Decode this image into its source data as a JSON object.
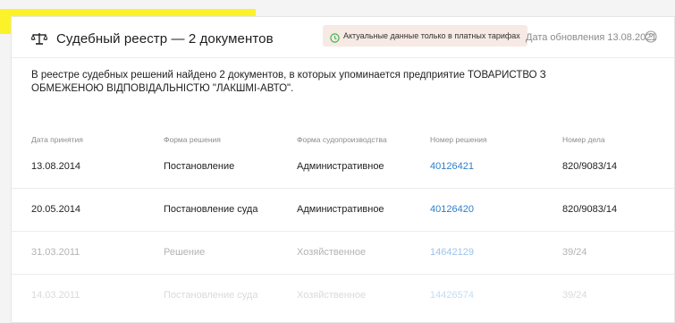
{
  "header": {
    "title": "Судебный реестр — 2 документов",
    "badge_text": "Актуальные данные только в платных тарифах",
    "updated": "Дата обновления 13.08.2021",
    "highlight_color": "#fbf22a",
    "icons": [
      "scales-icon",
      "clock-icon",
      "help-icon"
    ]
  },
  "description": "В реестре судебных решений найдено 2 документов, в которых упоминается предприятие ТОВАРИСТВО З ОБМЕЖЕНОЮ ВІДПОВІДАЛЬНІСТЮ \"ЛАКШМІ-АВТО\".",
  "table": {
    "columns": [
      "Дата принятия",
      "Форма решения",
      "Форма судопроизводства",
      "Номер решения",
      "Номер дела"
    ],
    "rows": [
      {
        "date": "13.08.2014",
        "form": "Постановление",
        "proceeding": "Административное",
        "decision": "40126421",
        "case": "820/9083/14"
      },
      {
        "date": "20.05.2014",
        "form": "Постановление суда",
        "proceeding": "Административное",
        "decision": "40126420",
        "case": "820/9083/14"
      },
      {
        "date": "31.03.2011",
        "form": "Решение",
        "proceeding": "Хозяйственное",
        "decision": "14642129",
        "case": "39/24"
      },
      {
        "date": "14.03.2011",
        "form": "Постановление суда",
        "proceeding": "Хозяйственное",
        "decision": "14426574",
        "case": "39/24"
      }
    ]
  },
  "colors": {
    "link": "#2d7fc8",
    "badge_bg": "#f7e9e3",
    "clock": "#3bb54a"
  }
}
